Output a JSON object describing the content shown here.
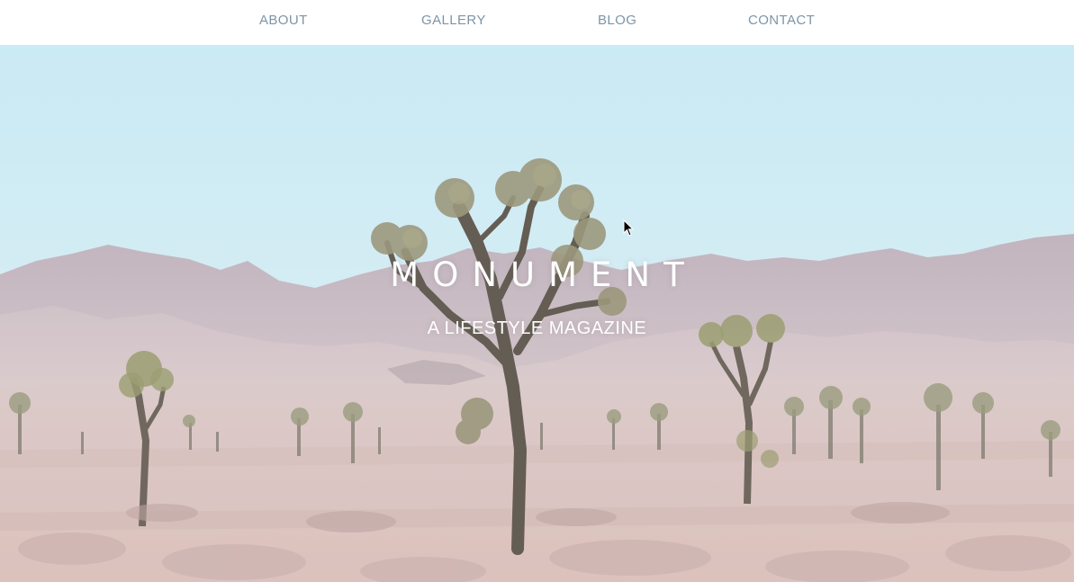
{
  "nav": {
    "items": [
      {
        "label": "ABOUT"
      },
      {
        "label": "GALLERY"
      },
      {
        "label": "BLOG"
      },
      {
        "label": "CONTACT"
      }
    ]
  },
  "hero": {
    "title": "MONUMENT",
    "subtitle": "A LIFESTYLE MAGAZINE",
    "image": "desert-joshua-tree-landscape"
  },
  "colors": {
    "nav_text": "#7e95a6",
    "sky_top": "#c4e9f4",
    "mountain": "#c8b9c0",
    "ground": "#d9c3c2"
  }
}
